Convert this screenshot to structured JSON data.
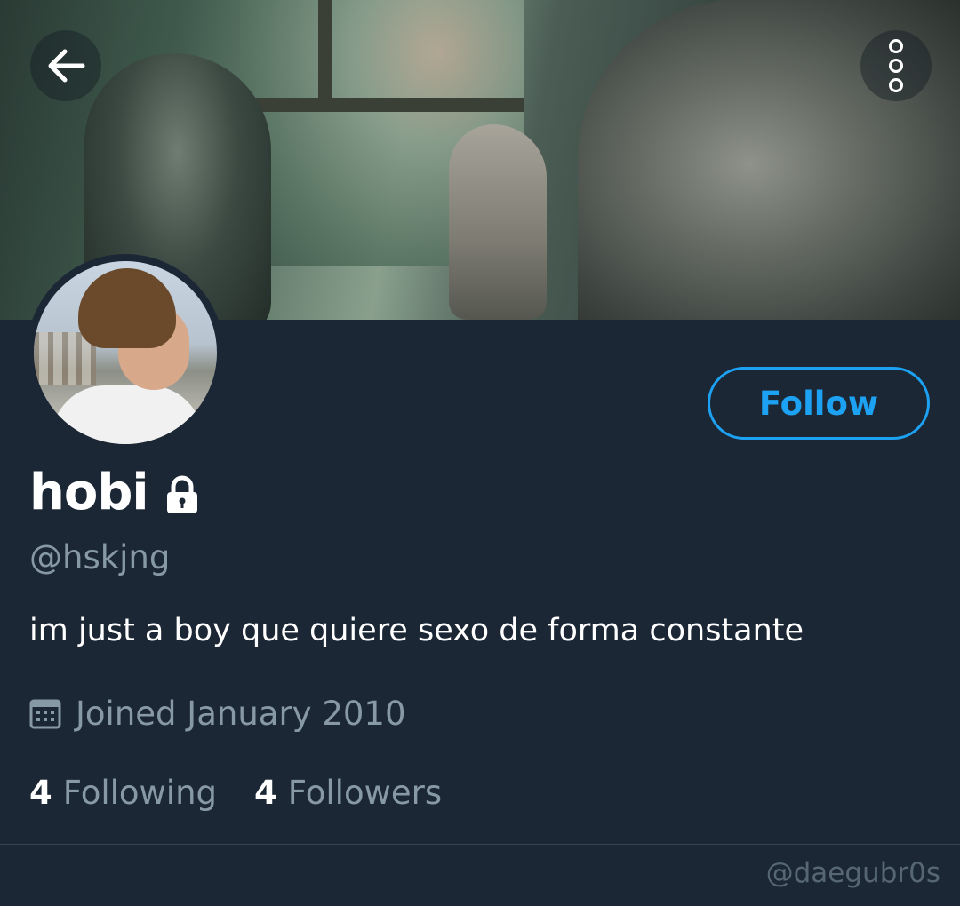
{
  "header": {
    "back_icon": "arrow-left-icon",
    "more_icon": "more-vertical-icon"
  },
  "profile": {
    "display_name": "hobi",
    "protected_icon": "lock-icon",
    "handle": "@hskjng",
    "bio": "im just a boy que quiere sexo de forma constante",
    "joined_icon": "calendar-icon",
    "joined": "Joined January 2010",
    "following_count": "4",
    "following_label": "Following",
    "followers_count": "4",
    "followers_label": "Followers"
  },
  "actions": {
    "follow_label": "Follow"
  },
  "watermark": "@daegubr0s",
  "colors": {
    "background": "#1c2735",
    "accent": "#1da1f2",
    "secondary_text": "#8899a6"
  }
}
